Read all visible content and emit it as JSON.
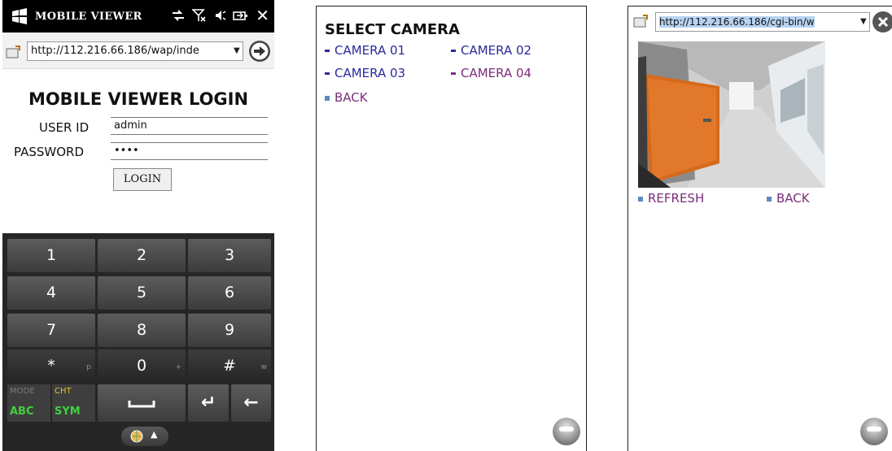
{
  "login_screen": {
    "titlebar": {
      "title": "MOBILE VIEWER",
      "icons": [
        "windows-flag-icon",
        "network-icon",
        "signal-icon",
        "volume-icon",
        "battery-icon",
        "close-icon"
      ],
      "close_glyph": "✕"
    },
    "address_bar": {
      "url": "http://112.216.66.186/wap/inde"
    },
    "form": {
      "heading": "MOBILE VIEWER LOGIN",
      "user_id_label": "USER ID",
      "user_id_value": "admin",
      "password_label": "PASSWORD",
      "password_value": "••••",
      "login_button": "LOGIN"
    },
    "keypad": {
      "keys": [
        {
          "label": "1",
          "sub": ""
        },
        {
          "label": "2",
          "sub": ""
        },
        {
          "label": "3",
          "sub": ""
        },
        {
          "label": "4",
          "sub": ""
        },
        {
          "label": "5",
          "sub": ""
        },
        {
          "label": "6",
          "sub": ""
        },
        {
          "label": "7",
          "sub": ""
        },
        {
          "label": "8",
          "sub": ""
        },
        {
          "label": "9",
          "sub": ""
        },
        {
          "label": "*",
          "sub": "p"
        },
        {
          "label": "0",
          "sub": "+"
        },
        {
          "label": "#",
          "sub": "w"
        }
      ],
      "mode_top": "MODE",
      "mode_bottom": "ABC",
      "cht_top": "CHT",
      "cht_bottom": "SYM",
      "enter_glyph": "↵",
      "backspace_glyph": "←",
      "caret_glyph": "▲"
    }
  },
  "select_screen": {
    "title": "SELECT CAMERA",
    "cameras": [
      "CAMERA 01",
      "CAMERA 02",
      "CAMERA 03",
      "CAMERA 04"
    ],
    "back": "BACK"
  },
  "view_screen": {
    "address_bar": {
      "url": "http://112.216.66.186/cgi-bin/w"
    },
    "refresh": "REFRESH",
    "back": "BACK"
  },
  "colors": {
    "link_blue": "#2a2a9a",
    "link_visited": "#7a2d7a",
    "keypad_bg": "#262626",
    "url_selection": "#b7d2f2"
  }
}
